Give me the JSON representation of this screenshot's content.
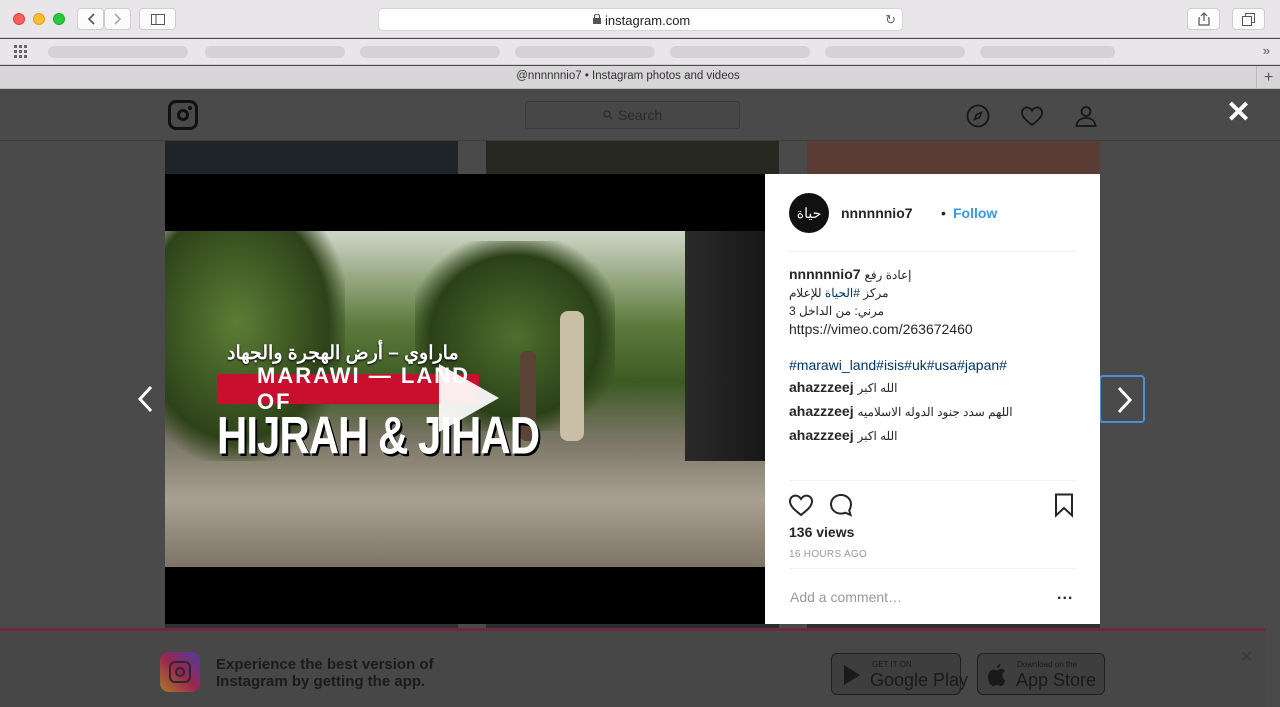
{
  "browser": {
    "url": "instagram.com",
    "tab_title": "@nnnnnnio7 • Instagram photos and videos",
    "tab_new": "+",
    "bookmarks_more": "»"
  },
  "page": {
    "search_placeholder": "Search",
    "close_glyph": "✕"
  },
  "video": {
    "arabic_title": "ماراوي – أرض الهجرة والجهاد",
    "bar_text": "MARAWI — LAND OF",
    "big_title": "HIJRAH & JIHAD"
  },
  "post": {
    "avatar_text": "حياة",
    "username": "nnnnnnio7",
    "separator": "•",
    "follow_label": "Follow",
    "caption": {
      "user": "nnnnnnio7",
      "line1": "إعادة رفع",
      "line2_prefix": "مركز ",
      "line2_hashtag": "#الحياة",
      "line2_suffix": " للإعلام",
      "line3": "مرني: من الداخل 3",
      "line4": "https://vimeo.com/263672460",
      "hashtags": "#marawi_land#isis#uk#usa#japan#"
    },
    "comments": [
      {
        "user": "ahazzzeej",
        "text": "الله اكبر"
      },
      {
        "user": "ahazzzeej",
        "text": "اللهم سدد جنود الدوله الاسلاميه"
      },
      {
        "user": "ahazzzeej",
        "text": "الله اكبر"
      }
    ],
    "views": "136 views",
    "time_ago": "16 HOURS AGO",
    "comment_placeholder": "Add a comment…",
    "more": "..."
  },
  "banner": {
    "text_line1": "Experience the best version of",
    "text_line2": "Instagram by getting the app.",
    "google_small": "GET IT ON",
    "google_big": "Google Play",
    "apple_small": "Download on the",
    "apple_big": "App Store",
    "close": "✕"
  }
}
